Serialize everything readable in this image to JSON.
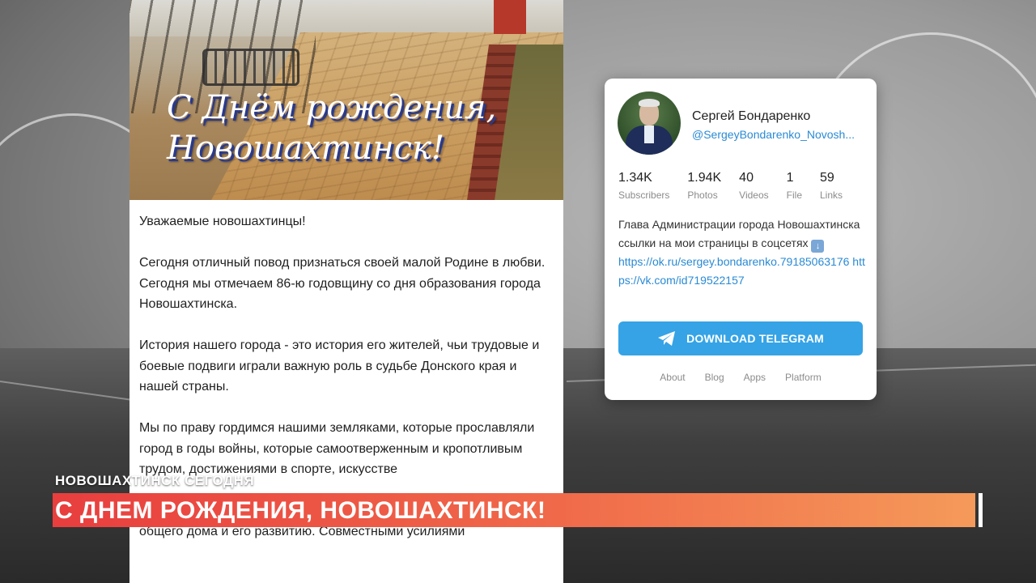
{
  "post": {
    "photo_title_line1": "С Днём рождения,",
    "photo_title_line2": "Новошахтинск!",
    "paragraphs": [
      "Уважаемые новошахтинцы!",
      "Сегодня отличный повод признаться своей малой Родине в любви.\nСегодня мы отмечаем 86-ю годовщину со дня образования города Новошахтинска.",
      "История нашего города - это история его жителей, чьи трудовые и боевые подвиги играли важную роль в судьбе Донского края и нашей страны.",
      "Мы по праву гордимся нашими земляками, которые прославляли город в годы войны, которые самоотверженным и кропотливым трудом, достижениями в спорте, искусстве",
      "Впереди у нас много серьезных задач по благоустройству нашего общего дома и его развитию. Совместными усилиями"
    ]
  },
  "channel": {
    "name": "Сергей Бондаренко",
    "handle": "@SergeyBondarenko_Novosh...",
    "stats": [
      {
        "value": "1.34K",
        "label": "Subscribers"
      },
      {
        "value": "1.94K",
        "label": "Photos"
      },
      {
        "value": "40",
        "label": "Videos"
      },
      {
        "value": "1",
        "label": "File"
      },
      {
        "value": "59",
        "label": "Links"
      }
    ],
    "description": "Глава Администрации города Новошахтинска ссылки на мои страницы в соцсетях",
    "links": "https://ok.ru/sergey.bondarenko.79185063176 https://vk.com/id719522157",
    "button_label": "DOWNLOAD TELEGRAM",
    "footer_links": [
      "About",
      "Blog",
      "Apps",
      "Platform"
    ]
  },
  "lower_third": {
    "subtitle": "НОВОШАХТИНСК СЕГОДНЯ",
    "title": "С ДНЕМ РОЖДЕНИЯ, НОВОШАХТИНСК!"
  },
  "colors": {
    "accent_blue": "#35a3e6",
    "link_blue": "#2a8ad4",
    "bar_start": "#e83e3e",
    "bar_end": "#f59a5a"
  }
}
